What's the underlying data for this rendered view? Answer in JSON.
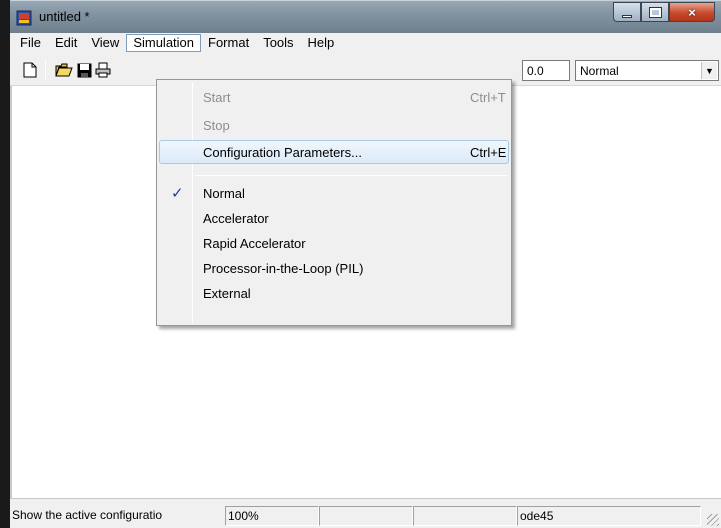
{
  "window": {
    "title": "untitled *",
    "caption_buttons": {
      "minimize": "minimize-icon",
      "maximize": "maximize-icon",
      "close": "×"
    }
  },
  "menubar": {
    "items": [
      "File",
      "Edit",
      "View",
      "Simulation",
      "Format",
      "Tools",
      "Help"
    ],
    "open_item": "Simulation"
  },
  "toolbar": {
    "icons": [
      "new-model-icon",
      "open-folder-icon",
      "save-icon",
      "print-icon"
    ],
    "stop_time": "0.0",
    "sim_mode": "Normal",
    "dropdown_arrow": "▼"
  },
  "simulation_menu": {
    "items": [
      {
        "label": "Start",
        "accel": "Ctrl+T",
        "enabled": false
      },
      {
        "label": "Stop",
        "accel": "",
        "enabled": false
      },
      {
        "label": "Configuration Parameters...",
        "accel": "Ctrl+E",
        "enabled": true,
        "highlighted": true
      },
      {
        "label": "Normal",
        "checked": true,
        "check_glyph": "✓"
      },
      {
        "label": "Accelerator"
      },
      {
        "label": "Rapid Accelerator"
      },
      {
        "label": "Processor-in-the-Loop (PIL)"
      },
      {
        "label": "External"
      }
    ]
  },
  "statusbar": {
    "message": "Show the active configuratio",
    "zoom": "100%",
    "cell3": "",
    "cell4": "",
    "solver": "ode45"
  }
}
